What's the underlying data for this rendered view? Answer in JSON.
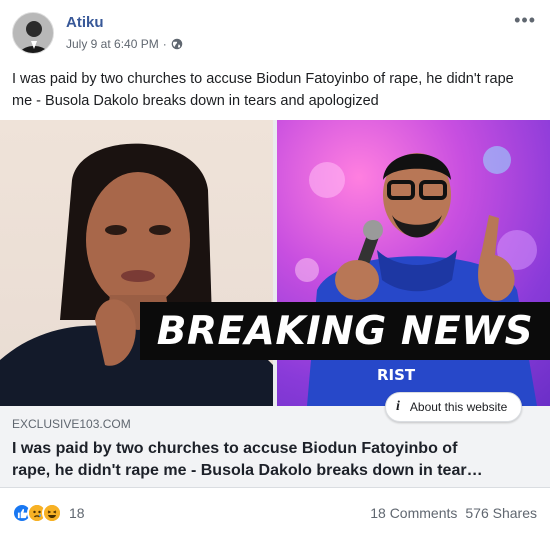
{
  "author": {
    "name": "Atiku"
  },
  "meta": {
    "timestamp": "July 9 at 6:40 PM",
    "separator": "·",
    "privacy_icon": "globe-icon"
  },
  "post": {
    "text": "I was paid by two churches to accuse Biodun Fatoyinbo of rape, he didn't rape me - Busola Dakolo breaks down in tears and apologized"
  },
  "link_preview": {
    "banner_text": "BREAKING NEWS",
    "shirt_text": "RIST",
    "about_label": "About this website",
    "domain": "EXCLUSIVE103.COM",
    "title_line1": "I was paid by two churches to accuse Biodun Fatoyinbo of",
    "title_line2": "rape, he didn't rape me - Busola Dakolo breaks down in tear…"
  },
  "footer": {
    "reactions": [
      "like-icon",
      "sad-icon",
      "haha-icon"
    ],
    "reaction_count": "18",
    "comments": "18 Comments",
    "shares": "576 Shares"
  },
  "colors": {
    "author": "#385898",
    "link_bg": "#f2f3f5",
    "like": "#1877f2"
  }
}
